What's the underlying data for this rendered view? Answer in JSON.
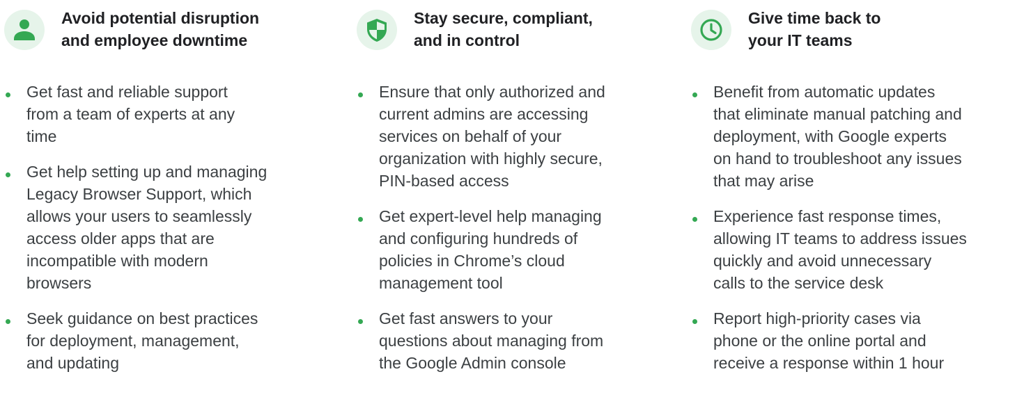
{
  "colors": {
    "accent": "#34a853",
    "icon_bg": "#e6f4ea",
    "title": "#202124",
    "body": "#3c4043"
  },
  "columns": [
    {
      "icon": "person-icon",
      "title_lines": [
        "Avoid potential disruption",
        "and employee downtime"
      ],
      "bullets": [
        {
          "lines": [
            "Get fast and reliable support",
            "from a team of experts at any",
            "time"
          ]
        },
        {
          "lines": [
            "Get help setting up and managing",
            "Legacy Browser Support, which",
            "allows your users to seamlessly",
            "access older apps that are",
            "incompatible with modern",
            "browsers"
          ]
        },
        {
          "lines": [
            "Seek guidance on best practices",
            "for deployment, management,",
            "and updating"
          ]
        }
      ]
    },
    {
      "icon": "shield-icon",
      "title_lines": [
        "Stay secure, compliant,",
        "and in control"
      ],
      "bullets": [
        {
          "lines": [
            "Ensure that only authorized and",
            "current admins are accessing",
            "services on behalf of your",
            "organization with highly secure,",
            "PIN-based access"
          ]
        },
        {
          "lines": [
            "Get expert-level help managing",
            "and configuring hundreds of",
            "policies in Chrome’s cloud",
            "management tool"
          ]
        },
        {
          "lines": [
            "Get fast answers to your",
            "questions about managing from",
            "the Google Admin console"
          ]
        }
      ]
    },
    {
      "icon": "clock-icon",
      "title_lines": [
        "Give time back to",
        "your IT teams"
      ],
      "bullets": [
        {
          "lines": [
            "Benefit from automatic updates",
            "that eliminate manual patching and",
            "deployment, with Google experts",
            "on hand to troubleshoot any issues",
            "that may arise"
          ]
        },
        {
          "lines": [
            "Experience fast response times,",
            "allowing IT teams to address issues",
            "quickly and avoid unnecessary",
            "calls to the service desk"
          ]
        },
        {
          "lines": [
            "Report high-priority cases via",
            "phone or the online portal and",
            "receive a response within 1 hour"
          ]
        }
      ]
    }
  ]
}
